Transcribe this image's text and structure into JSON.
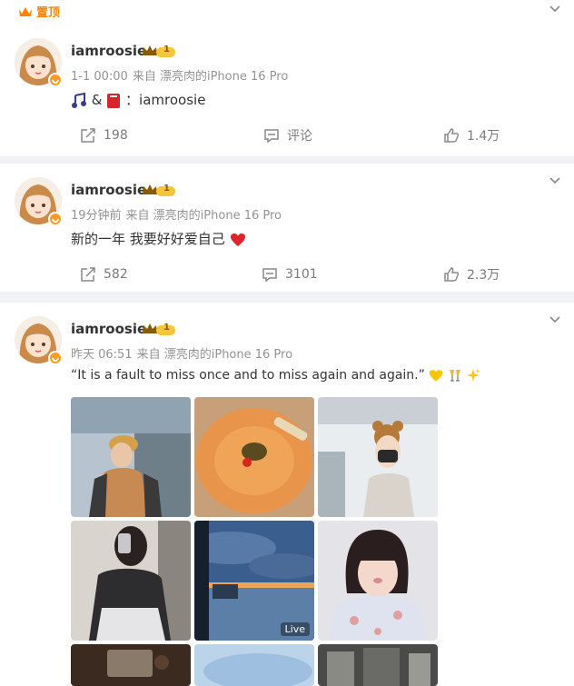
{
  "pinned_label": "置顶",
  "posts": [
    {
      "username": "iamroosie",
      "level": "1",
      "time": "1-1 00:00",
      "source": "来自 漂亮肉的iPhone 16 Pro",
      "text_suffix": "&",
      "text_main": "：iamroosie",
      "repost": "198",
      "comment": "评论",
      "like": "1.4万"
    },
    {
      "username": "iamroosie",
      "level": "1",
      "time": "19分钟前",
      "source": "来自 漂亮肉的iPhone 16 Pro",
      "text_main": "新的一年 我要好好爱自己",
      "repost": "582",
      "comment": "3101",
      "like": "2.3万"
    },
    {
      "username": "iamroosie",
      "level": "1",
      "time": "昨天 06:51",
      "source": "来自 漂亮肉的iPhone 16 Pro",
      "text_main": "“It is a fault to miss once and to miss again and again.”",
      "live_label": "Live"
    }
  ],
  "colors": {
    "accent": "#ff8200",
    "meta": "#939393",
    "bg": "#f1f2f5"
  }
}
